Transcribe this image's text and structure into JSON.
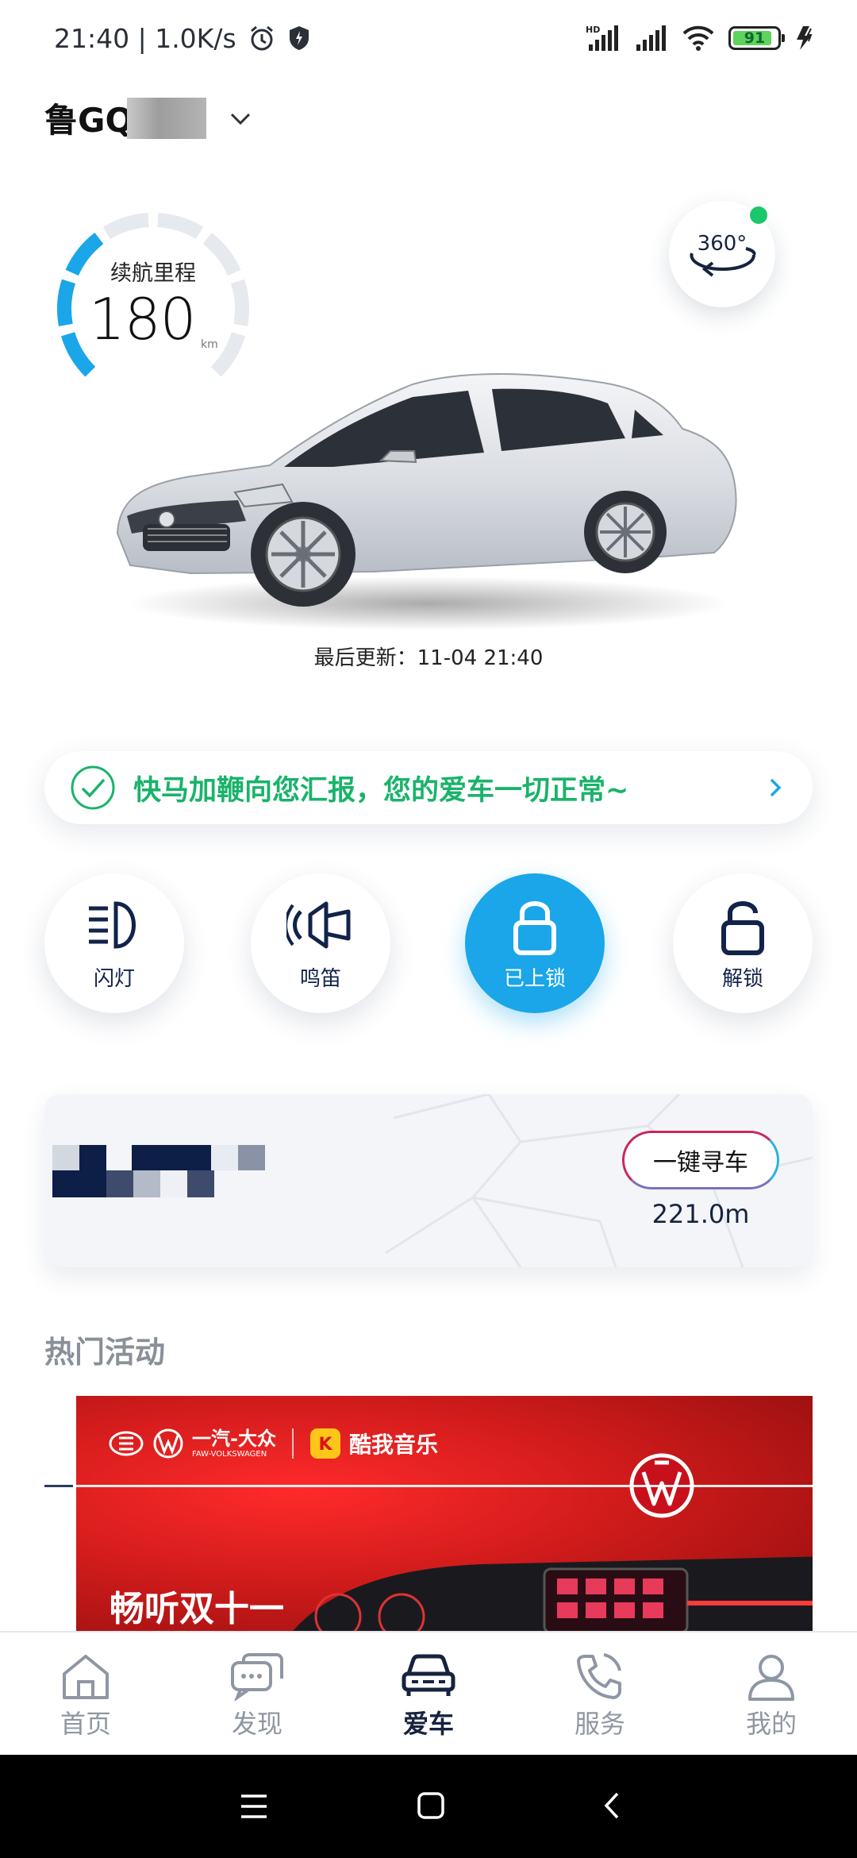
{
  "status_bar": {
    "time_speed": "21:40 | 1.0K/s",
    "battery": "91"
  },
  "vehicle": {
    "plate_prefix": "鲁GQ"
  },
  "range": {
    "label": "续航里程",
    "value": "180",
    "unit": "km",
    "fill_fraction": 0.38
  },
  "view360": {
    "label": "360°"
  },
  "last_update": "最后更新：11-04 21:40",
  "health_banner": {
    "text": "快马加鞭向您汇报，您的爱车一切正常~"
  },
  "controls": [
    {
      "label": "闪灯",
      "active": false
    },
    {
      "label": "鸣笛",
      "active": false
    },
    {
      "label": "已上锁",
      "active": true
    },
    {
      "label": "解锁",
      "active": false
    }
  ],
  "location": {
    "find_button": "一键寻车",
    "distance": "221.0m"
  },
  "hot_section": {
    "title": "热门活动",
    "banner_brand": "一汽-大众",
    "banner_brand_en": "FAW-VOLKSWAGEN",
    "banner_partner": "酷我音乐",
    "banner_title": "畅听双十一"
  },
  "tabs": [
    {
      "label": "首页",
      "icon": "home-icon",
      "active": false
    },
    {
      "label": "发现",
      "icon": "chat-icon",
      "active": false
    },
    {
      "label": "爱车",
      "icon": "car-icon",
      "active": true
    },
    {
      "label": "服务",
      "icon": "phone-icon",
      "active": false
    },
    {
      "label": "我的",
      "icon": "person-icon",
      "active": false
    }
  ],
  "colors": {
    "accent_blue": "#1aa6e8",
    "ok_green": "#19b36a",
    "navy": "#16233f"
  }
}
